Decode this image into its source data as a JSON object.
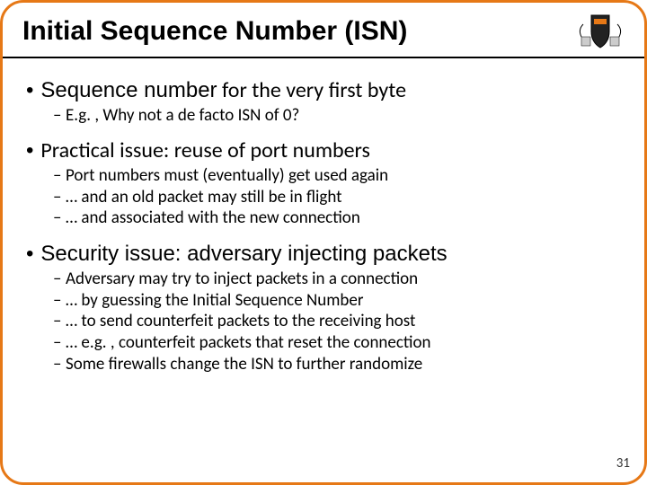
{
  "title": "Initial Sequence Number (ISN)",
  "blocks": [
    {
      "l1a": "Sequence number",
      "l1b": " for the very first byte",
      "subs": [
        "E.g. , Why not a de facto ISN of 0?"
      ]
    },
    {
      "l1a": "",
      "l1b": "Practical issue: reuse of port numbers",
      "subs": [
        "Port numbers must (eventually) get used again",
        "… and an old packet may still be in flight",
        "… and associated with the new connection"
      ]
    },
    {
      "l1a": "Security issue: adversary injecting packets",
      "l1b": "",
      "subs": [
        "Adversary may try to inject packets in a connection",
        "… by guessing the Initial Sequence Number",
        "… to send counterfeit packets to the receiving host",
        "… e.g. , counterfeit packets that reset the connection",
        "Some firewalls change the ISN to further randomize"
      ]
    }
  ],
  "page_number": "31"
}
